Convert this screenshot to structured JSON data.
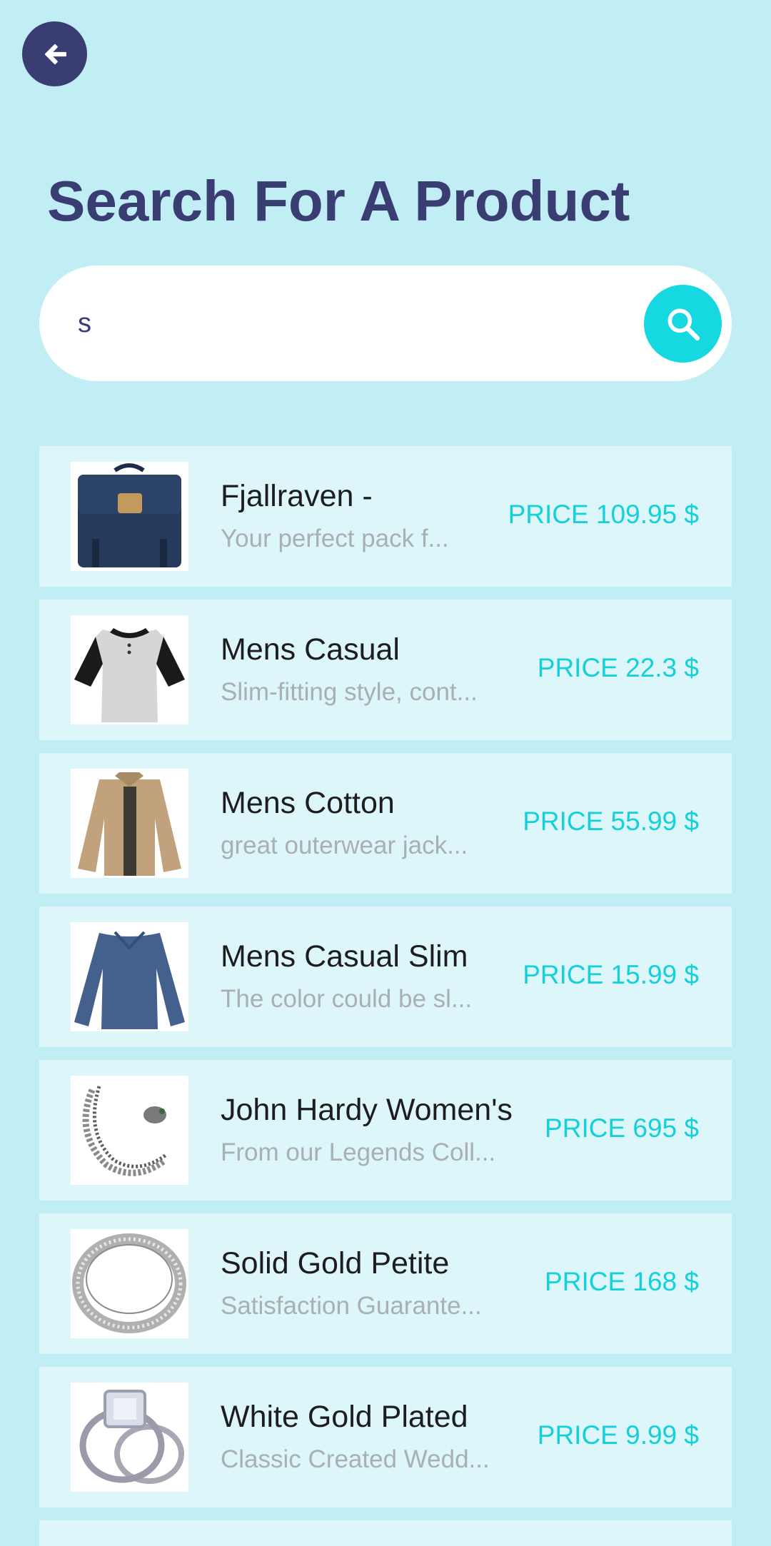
{
  "header": {
    "back_icon": "arrow-left-icon",
    "title": "Search For A Product"
  },
  "search": {
    "value": "s",
    "icon": "search-icon"
  },
  "products": [
    {
      "title": "Fjallraven -",
      "description": "Your perfect pack f...",
      "price": "PRICE 109.95 $",
      "image": "backpack"
    },
    {
      "title": "Mens Casual",
      "description": "Slim-fitting style, cont...",
      "price": "PRICE 22.3 $",
      "image": "raglan-tshirt"
    },
    {
      "title": "Mens Cotton",
      "description": "great outerwear jack...",
      "price": "PRICE 55.99 $",
      "image": "jacket"
    },
    {
      "title": "Mens Casual Slim",
      "description": "The color could be sl...",
      "price": "PRICE 15.99 $",
      "image": "long-sleeve-shirt"
    },
    {
      "title": "John Hardy Women's",
      "description": "From our Legends Coll...",
      "price": "PRICE 695 $",
      "image": "chain-bracelet"
    },
    {
      "title": "Solid Gold Petite",
      "description": "Satisfaction Guarante...",
      "price": "PRICE 168 $",
      "image": "ring"
    },
    {
      "title": "White Gold Plated",
      "description": "Classic Created Wedd...",
      "price": "PRICE 9.99 $",
      "image": "diamond-ring"
    }
  ],
  "colors": {
    "background": "#c1eef4",
    "primary": "#393d72",
    "accent": "#15d8e0",
    "row_background": "#dcf6fa"
  }
}
